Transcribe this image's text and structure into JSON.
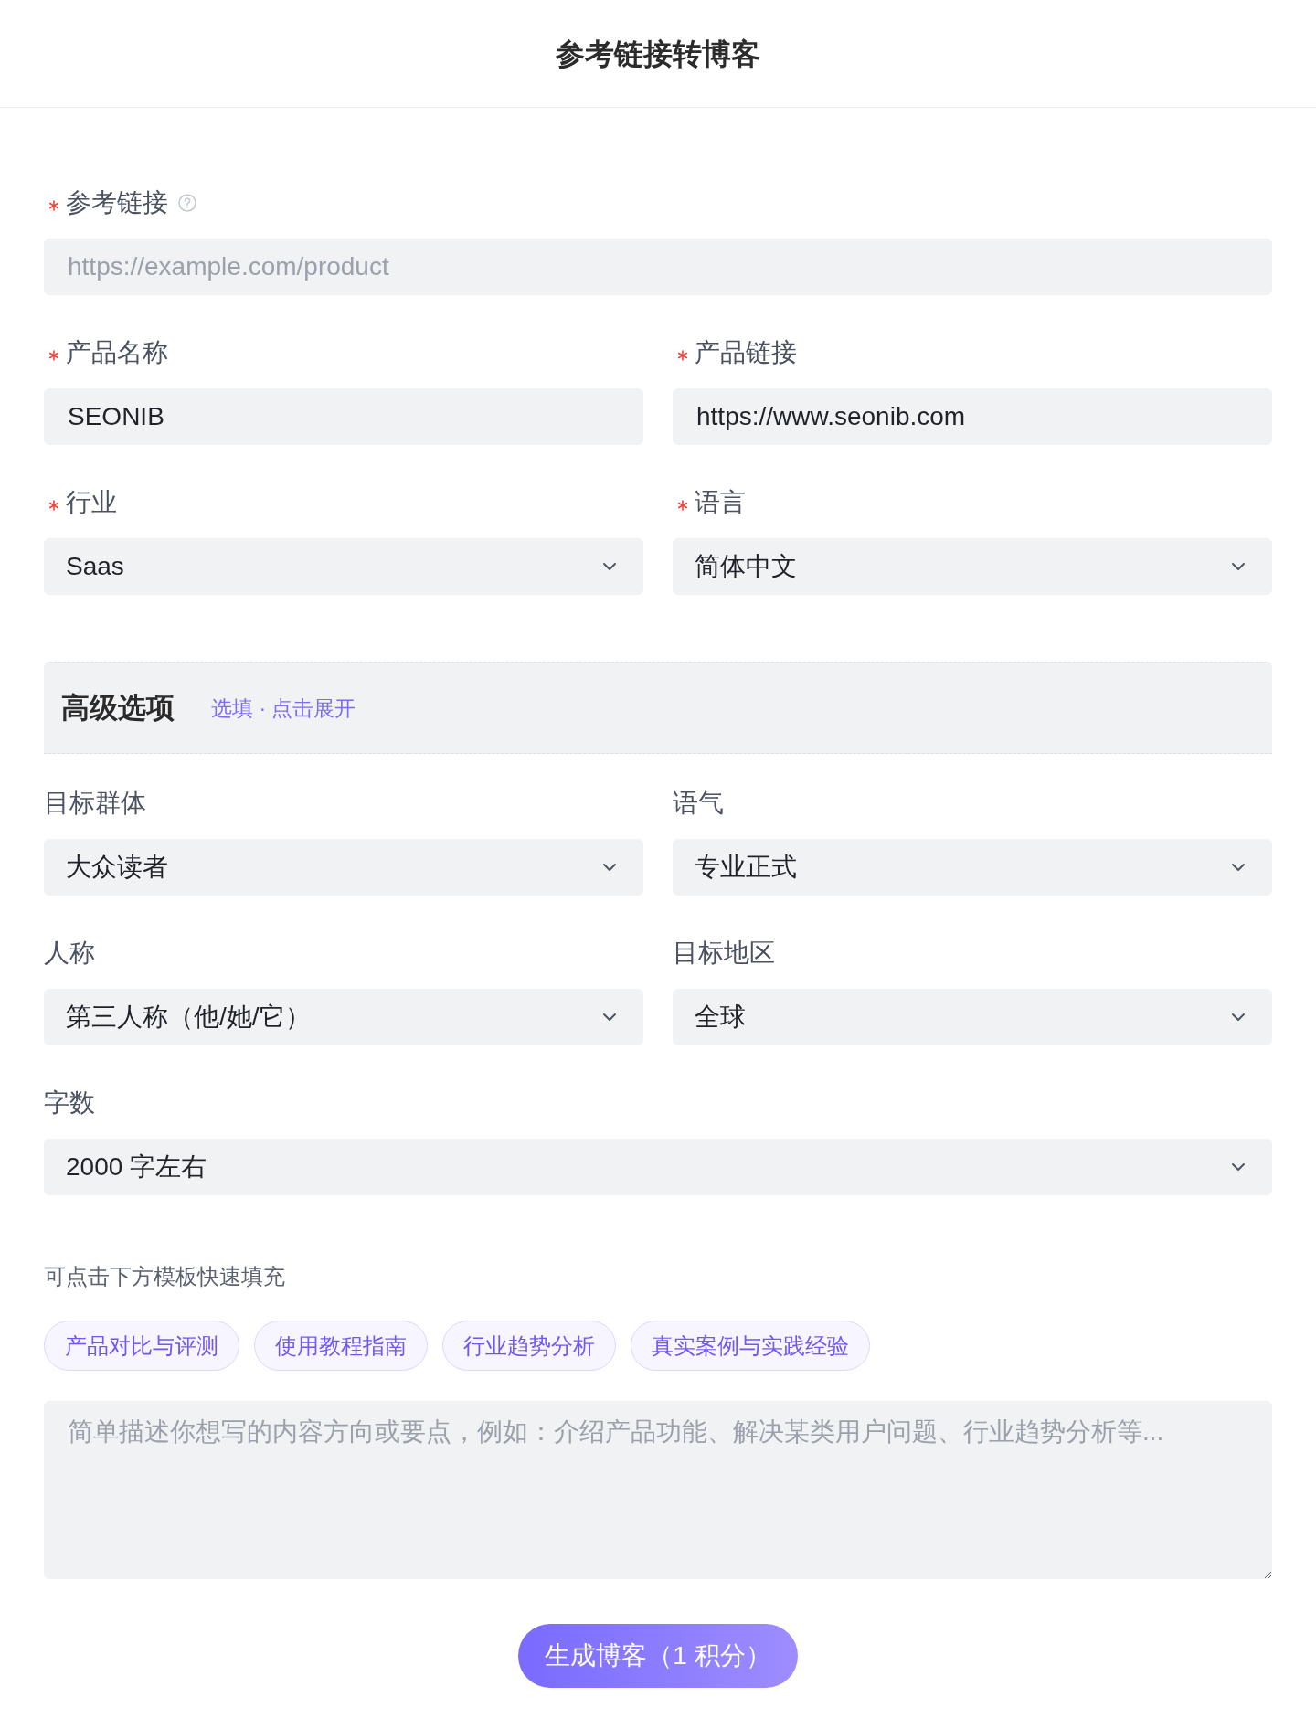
{
  "header": {
    "title": "参考链接转博客"
  },
  "basic_form": {
    "rows": [
      [
        {
          "kind": "text",
          "label": "参考链接",
          "required": true,
          "help": true,
          "placeholder": "https://example.com/product"
        }
      ],
      [
        {
          "kind": "text",
          "label": "产品名称",
          "required": true,
          "value": "SEONIB"
        },
        {
          "kind": "text",
          "label": "产品链接",
          "required": true,
          "value": "https://www.seonib.com"
        }
      ],
      [
        {
          "kind": "select",
          "label": "行业",
          "required": true,
          "value": "Saas"
        },
        {
          "kind": "select",
          "label": "语言",
          "required": true,
          "value": "简体中文"
        }
      ]
    ]
  },
  "advanced_options": {
    "title": "高级选项",
    "hint": "选填 · 点击展开",
    "rows": [
      [
        {
          "kind": "select",
          "label": "目标群体",
          "required": false,
          "value": "大众读者"
        },
        {
          "kind": "select",
          "label": "语气",
          "required": false,
          "value": "专业正式"
        }
      ],
      [
        {
          "kind": "select",
          "label": "人称",
          "required": false,
          "value": "第三人称（他/她/它）"
        },
        {
          "kind": "select",
          "label": "目标地区",
          "required": false,
          "value": "全球"
        }
      ],
      [
        {
          "kind": "select",
          "label": "字数",
          "required": false,
          "value": "2000 字左右"
        }
      ]
    ]
  },
  "templates": {
    "hint": "可点击下方模板快速填充",
    "chips": [
      "产品对比与评测",
      "使用教程指南",
      "行业趋势分析",
      "真实案例与实践经验"
    ]
  },
  "description": {
    "placeholder": "简单描述你想写的内容方向或要点，例如：介绍产品功能、解决某类用户问题、行业趋势分析等..."
  },
  "submit_button": {
    "label": "生成博客（1 积分）"
  }
}
